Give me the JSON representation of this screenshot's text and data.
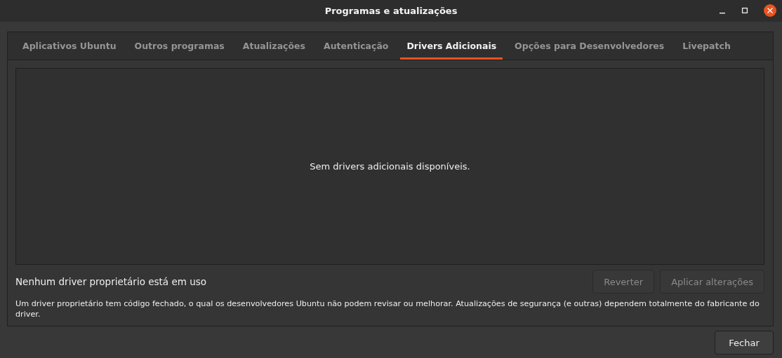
{
  "window": {
    "title": "Programas e atualizações",
    "controls": [
      {
        "kind": "minimize"
      },
      {
        "kind": "maximize"
      },
      {
        "kind": "close"
      }
    ]
  },
  "tabs": [
    {
      "label": "Aplicativos Ubuntu",
      "selected": false
    },
    {
      "label": "Outros programas",
      "selected": false
    },
    {
      "label": "Atualizações",
      "selected": false
    },
    {
      "label": "Autenticação",
      "selected": false
    },
    {
      "label": "Drivers Adicionais",
      "selected": true
    },
    {
      "label": "Opções para Desenvolvedores",
      "selected": false
    },
    {
      "label": "Livepatch",
      "selected": false
    }
  ],
  "drivers_list": {
    "empty_message": "Sem drivers adicionais disponíveis."
  },
  "status": "Nenhum driver proprietário está em uso",
  "buttons": [
    {
      "label": "Reverter",
      "disabled": true
    },
    {
      "label": "Aplicar alterações",
      "disabled": true
    }
  ],
  "note": "Um driver proprietário tem código fechado, o qual os desenvolvedores Ubuntu não podem revisar ou melhorar. Atualizações de segurança (e outras) dependem totalmente do fabricante do driver.",
  "close_button": {
    "label": "Fechar",
    "disabled": false
  }
}
